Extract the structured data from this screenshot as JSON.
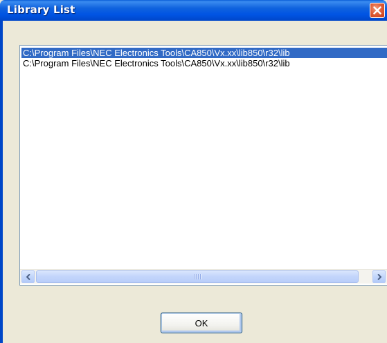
{
  "window": {
    "title": "Library List",
    "close_icon": "close-x-icon",
    "accent_color": "#0054E3",
    "close_color": "#E0603A"
  },
  "list": {
    "items": [
      {
        "path": "C:\\Program Files\\NEC Electronics Tools\\CA850\\Vx.xx\\lib850\\r32\\lib",
        "selected": true
      },
      {
        "path": "C:\\Program Files\\NEC Electronics Tools\\CA850\\Vx.xx\\lib850\\r32\\lib",
        "selected": false
      }
    ],
    "selection_color": "#316AC5"
  },
  "scrollbar": {
    "left_icon": "chevron-left-icon",
    "right_icon": "chevron-right-icon",
    "grip_icon": "scroll-grip-icon"
  },
  "buttons": {
    "ok_label": "OK"
  }
}
